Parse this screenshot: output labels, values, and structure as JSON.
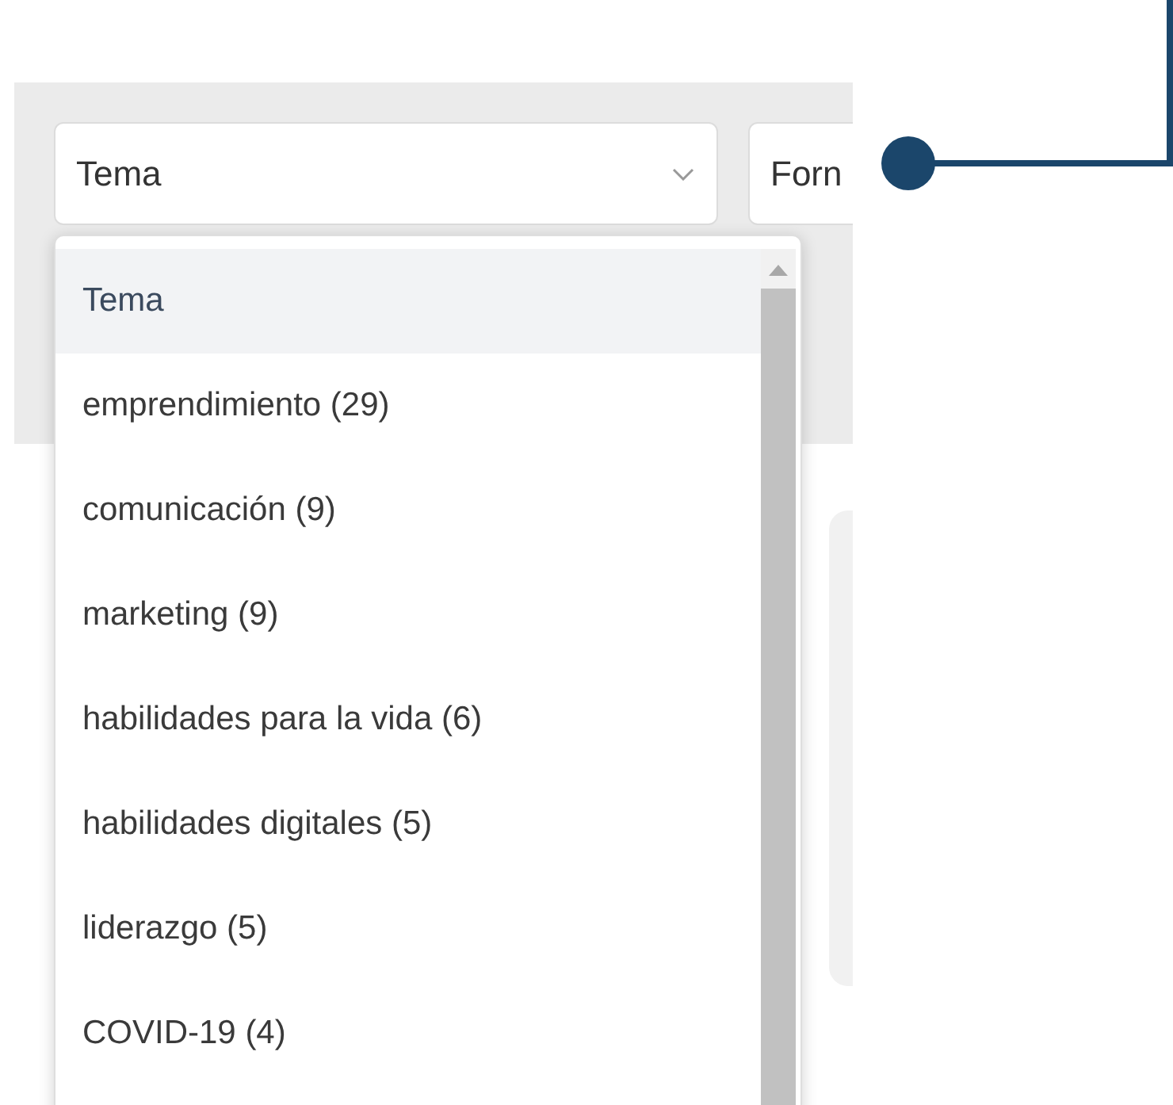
{
  "filters": [
    {
      "value": "Tema",
      "options": [
        {
          "label": "Tema",
          "selected": true
        },
        {
          "label": "emprendimiento (29)",
          "selected": false
        },
        {
          "label": "comunicación (9)",
          "selected": false
        },
        {
          "label": "marketing (9)",
          "selected": false
        },
        {
          "label": "habilidades para la vida (6)",
          "selected": false
        },
        {
          "label": "habilidades digitales (5)",
          "selected": false
        },
        {
          "label": "liderazgo (5)",
          "selected": false
        },
        {
          "label": "COVID-19 (4)",
          "selected": false
        }
      ]
    },
    {
      "value": "Forn"
    }
  ]
}
